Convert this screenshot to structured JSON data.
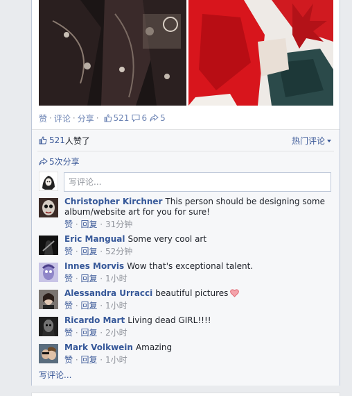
{
  "post": {
    "actions": {
      "like": "赞",
      "comment": "评论",
      "share": "分享",
      "like_count": "521",
      "comment_count": "6",
      "share_count": "5"
    },
    "summary": {
      "likes_count": "521",
      "likes_suffix": " 人赞了",
      "sort_label": "热门评论",
      "shares_label": "5次分享"
    },
    "composer": {
      "placeholder": "写评论..."
    },
    "comments": [
      {
        "author": "Christopher Kirchner",
        "text": "This person should be designing some album/website art for you for sure!",
        "like": "赞",
        "reply": "回复",
        "time": "31分钟"
      },
      {
        "author": "Eric Mangual",
        "text": "Some very cool art",
        "like": "赞",
        "reply": "回复",
        "time": "52分钟"
      },
      {
        "author": "Innes Morvis",
        "text": "Wow that's exceptional talent.",
        "like": "赞",
        "reply": "回复",
        "time": "1小时"
      },
      {
        "author": "Alessandra Urracci",
        "text": "beautiful pictures",
        "like": "赞",
        "reply": "回复",
        "time": "1小时"
      },
      {
        "author": "Ricardo Mart",
        "text": "Living dead GIRL!!!!",
        "like": "赞",
        "reply": "回复",
        "time": "2小时"
      },
      {
        "author": "Mark Volkwein",
        "text": "Amazing",
        "like": "赞",
        "reply": "回复",
        "time": "1小时"
      }
    ],
    "more_comments": "写评论...",
    "colors": {
      "link": "#3b5998",
      "meta": "#90949c",
      "heart": "#e06b75"
    }
  }
}
